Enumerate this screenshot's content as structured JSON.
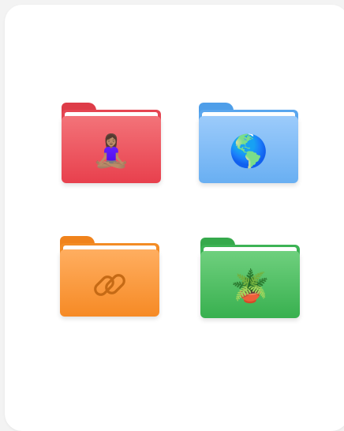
{
  "folders": [
    {
      "id": "red",
      "icon_name": "person-meditating-icon",
      "glyph": "🧘🏽‍♀️",
      "colors": {
        "tab": "#de3c48",
        "back": "#e54552",
        "front_top": "#f37379",
        "front_bottom": "#e8404d"
      }
    },
    {
      "id": "blue",
      "icon_name": "globe-americas-icon",
      "glyph": "🌎",
      "colors": {
        "tab": "#4e9ee9",
        "back": "#5aa6ee",
        "front_top": "#9ccbfb",
        "front_bottom": "#69aff2"
      }
    },
    {
      "id": "orange",
      "icon_name": "link-icon",
      "glyph": "",
      "colors": {
        "tab": "#f0831c",
        "back": "#f38c25",
        "front_top": "#ffae60",
        "front_bottom": "#f68a25",
        "icon_stroke": "#c56a15"
      }
    },
    {
      "id": "green",
      "icon_name": "potted-plant-icon",
      "glyph": "🪴",
      "colors": {
        "tab": "#36a94c",
        "back": "#3db355",
        "front_top": "#6fd07e",
        "front_bottom": "#38b04f"
      }
    }
  ]
}
